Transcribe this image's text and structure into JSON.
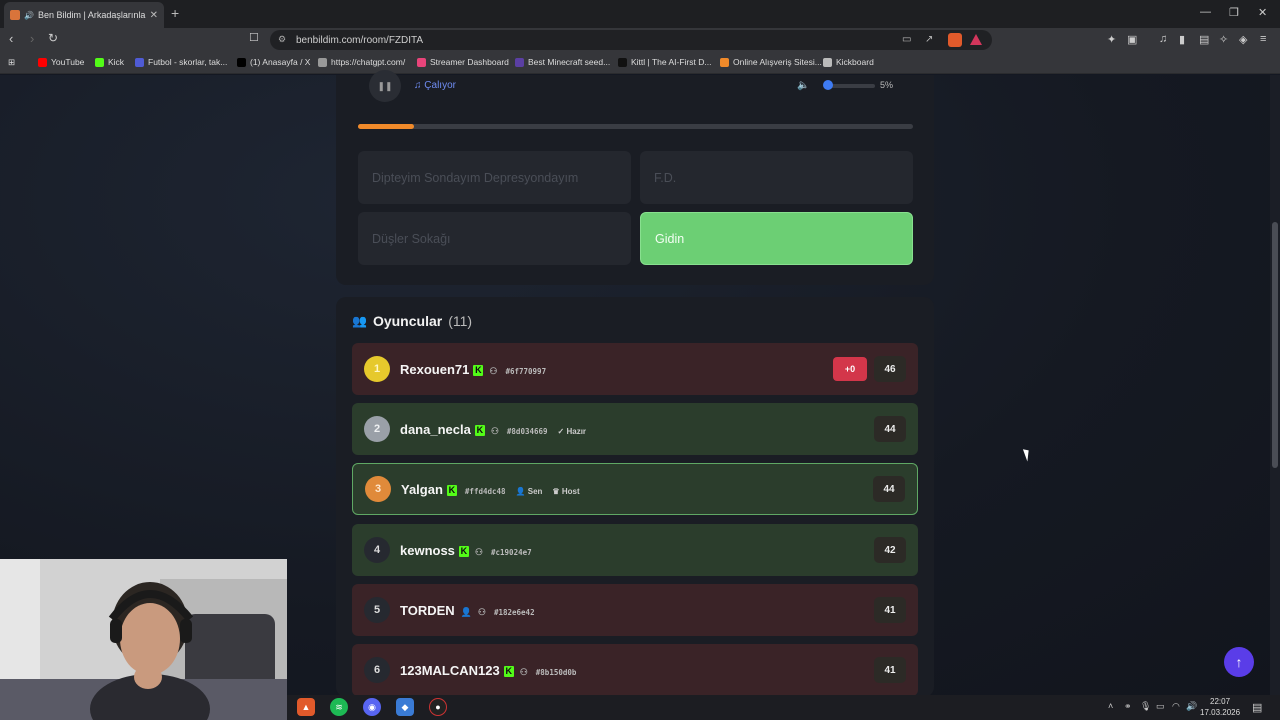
{
  "browser": {
    "tab_title": "Ben Bildim | Arkadaşlarınla Oy",
    "url": "benbildim.com/room/FZDITA",
    "bookmarks": [
      {
        "label": "YouTube",
        "color": "#ff0000"
      },
      {
        "label": "Kick",
        "color": "#53fc18"
      },
      {
        "label": "Futbol - skorlar, tak...",
        "color": "#4f5bd5"
      },
      {
        "label": "(1) Anasayfa / X",
        "color": "#000000"
      },
      {
        "label": "https://chatgpt.com/",
        "color": "#999999"
      },
      {
        "label": "Streamer Dashboard",
        "color": "#e8447a"
      },
      {
        "label": "Best Minecraft seed...",
        "color": "#5b3fa3"
      },
      {
        "label": "Kittl | The AI-First D...",
        "color": "#111111"
      },
      {
        "label": "Online Alışveriş Sitesi...",
        "color": "#f08a2a"
      },
      {
        "label": "Kickboard",
        "color": "#bbbbbb"
      }
    ]
  },
  "player": {
    "playing_label": "Çalıyor",
    "volume_label": "5%",
    "progress_fraction": 0.1
  },
  "options": [
    {
      "label": "Dipteyim Sondayım Depresyondayım",
      "state": "disabled"
    },
    {
      "label": "F.D.",
      "state": "disabled"
    },
    {
      "label": "Düşler Sokağı",
      "state": "disabled"
    },
    {
      "label": "Gidin",
      "state": "correct"
    }
  ],
  "players_section": {
    "title": "Oyuncular",
    "count": "(11)"
  },
  "players": [
    {
      "rank": "1",
      "name": "Rexouen71",
      "kick": true,
      "code": "#6f770997",
      "tags": [],
      "delta": "+0",
      "score": "46",
      "row": "red"
    },
    {
      "rank": "2",
      "name": "dana_necla",
      "kick": true,
      "code": "#8d034669",
      "tags": [
        "Hazır"
      ],
      "delta": "",
      "score": "44",
      "row": "green"
    },
    {
      "rank": "3",
      "name": "Yalgan",
      "kick": true,
      "code": "#ffd4dc48",
      "tags": [
        "Sen",
        "Host"
      ],
      "delta": "",
      "score": "44",
      "row": "green-me"
    },
    {
      "rank": "4",
      "name": "kewnoss",
      "kick": true,
      "code": "#c19024e7",
      "tags": [],
      "delta": "",
      "score": "42",
      "row": "green"
    },
    {
      "rank": "5",
      "name": "TORDEN",
      "kick": false,
      "code": "#182e6e42",
      "tags": [],
      "delta": "",
      "score": "41",
      "row": "red"
    },
    {
      "rank": "6",
      "name": "123MALCAN123",
      "kick": true,
      "code": "#8b150d0b",
      "tags": [],
      "delta": "",
      "score": "41",
      "row": "red"
    }
  ],
  "clock": {
    "time": "22:07",
    "date": "17.03.2026"
  }
}
